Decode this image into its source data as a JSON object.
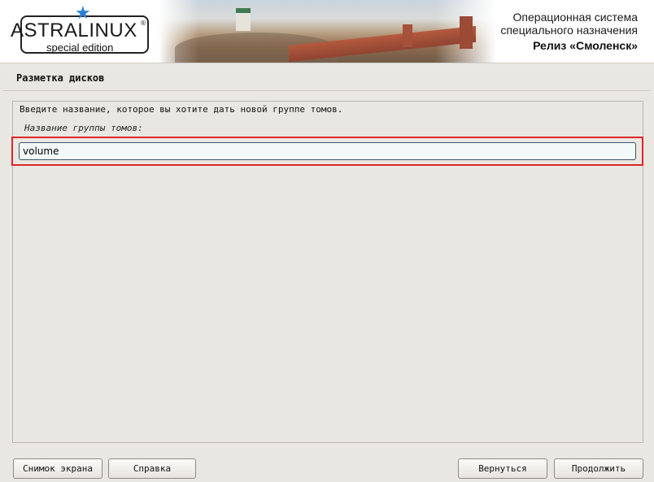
{
  "header": {
    "logo_main": "ASTRALINUX",
    "logo_registered": "®",
    "logo_sub": "special edition",
    "os_title_line1": "Операционная система",
    "os_title_line2": "специального назначения",
    "release": "Релиз «Смоленск»"
  },
  "page": {
    "title": "Разметка дисков"
  },
  "form": {
    "instruction": "Введите название, которое вы хотите дать новой группе томов.",
    "field_label": "Название группы томов:",
    "field_value": "volume"
  },
  "buttons": {
    "screenshot": "Снимок экрана",
    "help": "Справка",
    "back": "Вернуться",
    "continue": "Продолжить"
  },
  "colors": {
    "accent_star": "#2a7fd0",
    "highlight_border": "#e0252b",
    "background": "#e9e7e1"
  }
}
